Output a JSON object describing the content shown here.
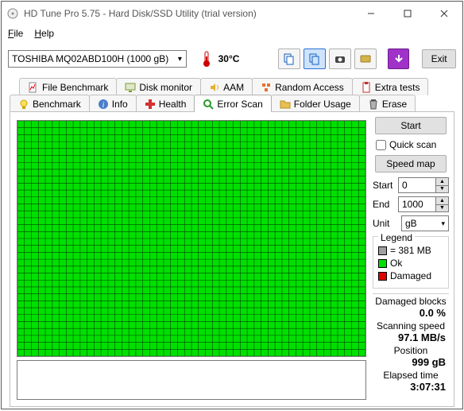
{
  "window": {
    "title": "HD Tune Pro 5.75 - Hard Disk/SSD Utility (trial version)"
  },
  "menu": {
    "file": "File",
    "help": "Help"
  },
  "toolbar": {
    "drive": "TOSHIBA MQ02ABD100H (1000 gB)",
    "temperature": "30°C",
    "exit_label": "Exit"
  },
  "tabs_row1": {
    "file_benchmark": "File Benchmark",
    "disk_monitor": "Disk monitor",
    "aam": "AAM",
    "random_access": "Random Access",
    "extra_tests": "Extra tests"
  },
  "tabs_row2": {
    "benchmark": "Benchmark",
    "info": "Info",
    "health": "Health",
    "error_scan": "Error Scan",
    "folder_usage": "Folder Usage",
    "erase": "Erase"
  },
  "sidebar": {
    "start_label": "Start",
    "quick_scan_label": "Quick scan",
    "speed_map_label": "Speed map",
    "start_field_label": "Start",
    "start_value": "0",
    "end_label": "End",
    "end_value": "1000",
    "unit_label": "Unit",
    "unit_value": "gB",
    "legend": {
      "title": "Legend",
      "block_size": "= 381 MB",
      "ok": "Ok",
      "damaged": "Damaged"
    },
    "stats": {
      "damaged_blocks_label": "Damaged blocks",
      "damaged_blocks_value": "0.0 %",
      "scanning_speed_label": "Scanning speed",
      "scanning_speed_value": "97.1 MB/s",
      "position_label": "Position",
      "position_value": "999 gB",
      "elapsed_time_label": "Elapsed time",
      "elapsed_time_value": "3:07:31"
    }
  }
}
